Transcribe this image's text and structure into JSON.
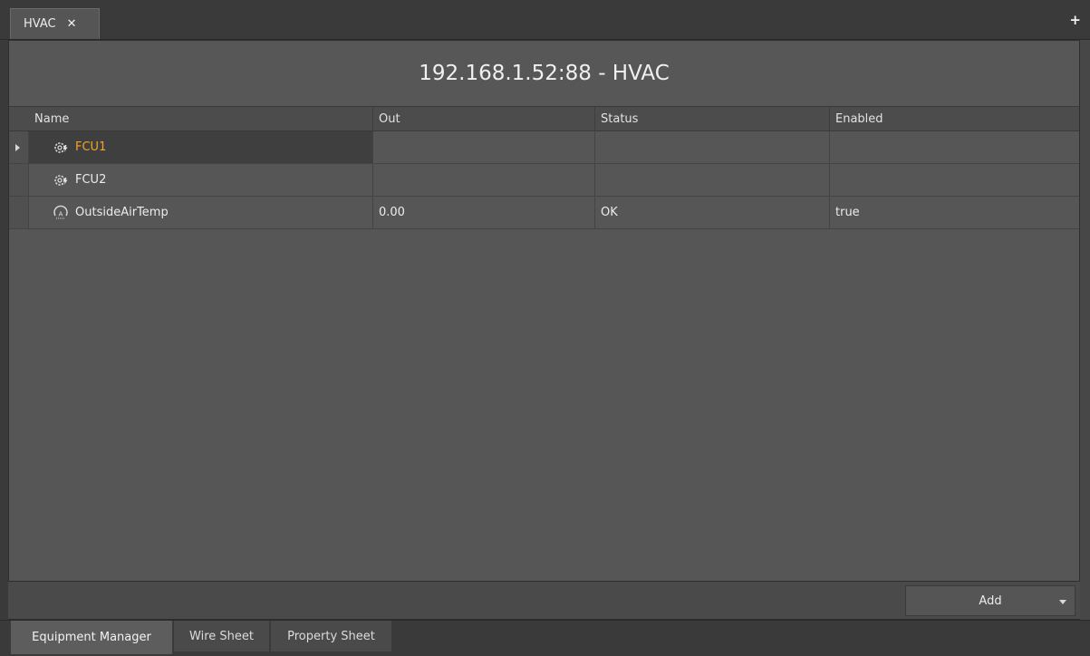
{
  "tabs": [
    {
      "label": "HVAC",
      "close_icon": "close-icon",
      "active": true
    }
  ],
  "add_tab_icon": "+",
  "panel": {
    "title": "192.168.1.52:88 - HVAC"
  },
  "grid": {
    "columns": [
      "Name",
      "Out",
      "Status",
      "Enabled"
    ],
    "rows": [
      {
        "name": "FCU1",
        "icon": "gear-bolt-icon",
        "out": "",
        "status": "",
        "enabled": "",
        "selected": true,
        "expandable": true
      },
      {
        "name": "FCU2",
        "icon": "gear-bolt-icon",
        "out": "",
        "status": "",
        "enabled": "",
        "selected": false,
        "expandable": false
      },
      {
        "name": "OutsideAirTemp",
        "icon": "analog-point-icon",
        "out": "0.00",
        "status": "OK",
        "enabled": "true",
        "selected": false,
        "expandable": false
      }
    ]
  },
  "add_button": {
    "label": "Add",
    "icon": "dropdown-caret-icon"
  },
  "view_tabs": [
    {
      "label": "Equipment Manager",
      "active": true
    },
    {
      "label": "Wire Sheet",
      "active": false
    },
    {
      "label": "Property Sheet",
      "active": false
    }
  ],
  "colors": {
    "selected_text": "#f0a62a",
    "panel_bg": "#565656",
    "app_bg": "#3a3a3a"
  }
}
